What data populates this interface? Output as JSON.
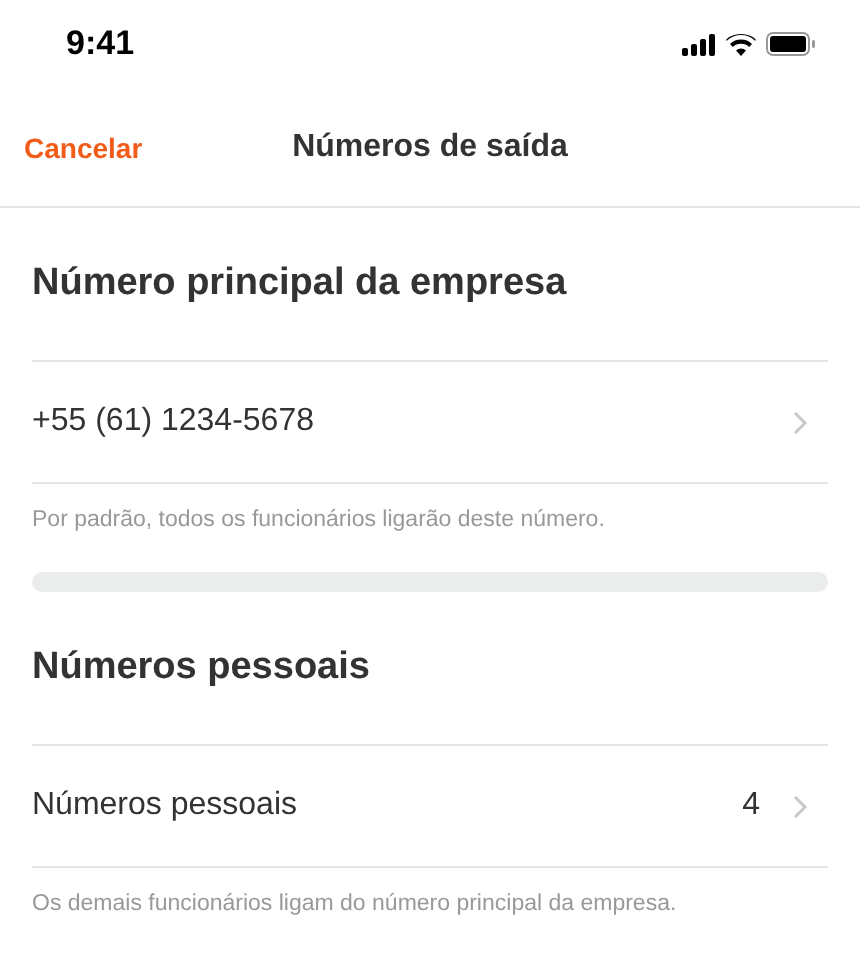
{
  "status_bar": {
    "time": "9:41"
  },
  "nav": {
    "cancel": "Cancelar",
    "title": "Números de saída"
  },
  "sections": [
    {
      "title": "Número principal da empresa",
      "rows": [
        {
          "label": "+55 (61) 1234-5678"
        }
      ],
      "note": "Por padrão, todos os funcionários ligarão deste número."
    },
    {
      "title": "Números pessoais",
      "rows": [
        {
          "label": "Números pessoais",
          "value": "4"
        }
      ],
      "note": "Os demais funcionários ligam do número principal da empresa."
    }
  ]
}
